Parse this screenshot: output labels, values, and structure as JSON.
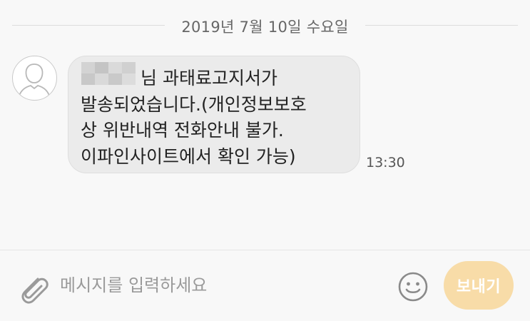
{
  "date_divider": {
    "text": "2019년 7월 10일 수요일"
  },
  "message": {
    "line1": "님 과태료고지서가",
    "body": "발송되었습니다.(개인정보보호\n상 위반내역 전화안내 불가.\n이파인사이트에서 확인 가능)",
    "time": "13:30",
    "avatar_icon": "person-silhouette-icon"
  },
  "composer": {
    "placeholder": "메시지를 입력하세요",
    "send_label": "보내기",
    "attach_icon": "paperclip-icon",
    "emoji_icon": "smiley-icon"
  },
  "colors": {
    "background": "#f8f8f8",
    "bubble": "#ebebeb",
    "send_button": "#f8dca8"
  }
}
